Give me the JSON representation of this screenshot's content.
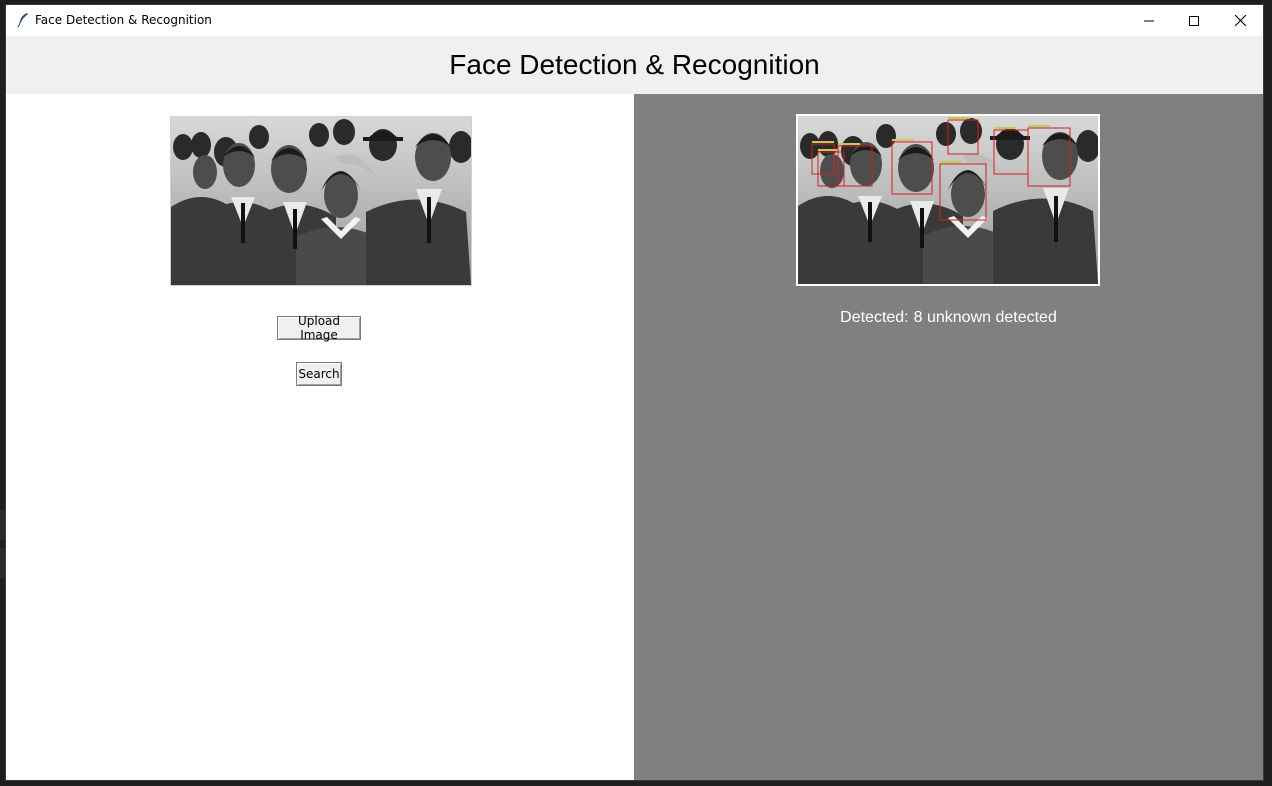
{
  "window": {
    "title": "Face Detection & Recognition",
    "controls": {
      "minimize_icon": "minimize-icon",
      "maximize_icon": "maximize-icon",
      "close_icon": "close-icon"
    }
  },
  "header": {
    "title": "Face Detection & Recognition"
  },
  "left_panel": {
    "image_alt": "uploaded-photo",
    "upload_button": "Upload Image",
    "search_button": "Search"
  },
  "right_panel": {
    "image_alt": "detection-result-photo",
    "detected_label": "Detected:",
    "detected_value": "8 unknown detected",
    "box_color": "#d11f1f"
  },
  "colors": {
    "header_bg": "#f0f0f0",
    "left_bg": "#ffffff",
    "right_bg": "#808080",
    "detected_text": "#ffffff"
  }
}
